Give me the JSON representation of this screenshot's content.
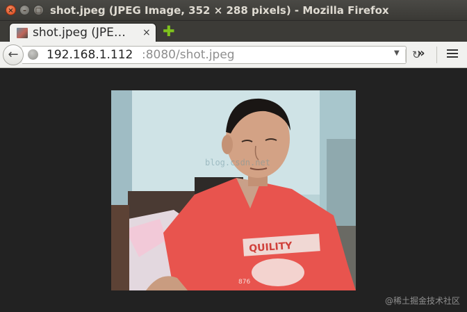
{
  "window": {
    "title": "shot.jpeg (JPEG Image, 352 × 288 pixels) - Mozilla Firefox",
    "close_glyph": "×",
    "minimize_glyph": "–",
    "maximize_glyph": "□"
  },
  "tab": {
    "title": "shot.jpeg (JPE…",
    "close_glyph": "×",
    "new_tab_glyph": "✚"
  },
  "navbar": {
    "back_glyph": "←",
    "url_host": "192.168.1.112",
    "url_rest": ":8080/shot.jpeg",
    "dropdown_glyph": "▼",
    "reload_glyph": "↻",
    "overflow_glyph": "»"
  },
  "image": {
    "shirt_text": "QUILITY",
    "shirt_number": "876",
    "overlay_text": "blog.csdn.net"
  },
  "watermark": "@稀土掘金技术社区",
  "icons": [
    "close-icon",
    "minimize-icon",
    "maximize-icon",
    "favicon-icon",
    "new-tab-icon",
    "back-arrow-icon",
    "globe-icon",
    "dropdown-icon",
    "reload-icon",
    "overflow-icon",
    "hamburger-menu-icon"
  ],
  "colors": {
    "content_bg": "#222222",
    "titlebar_bg": "#3c3b37",
    "close_button": "#e0562a",
    "new_tab_green": "#7fc31d",
    "shirt_color": "#e8544e"
  }
}
